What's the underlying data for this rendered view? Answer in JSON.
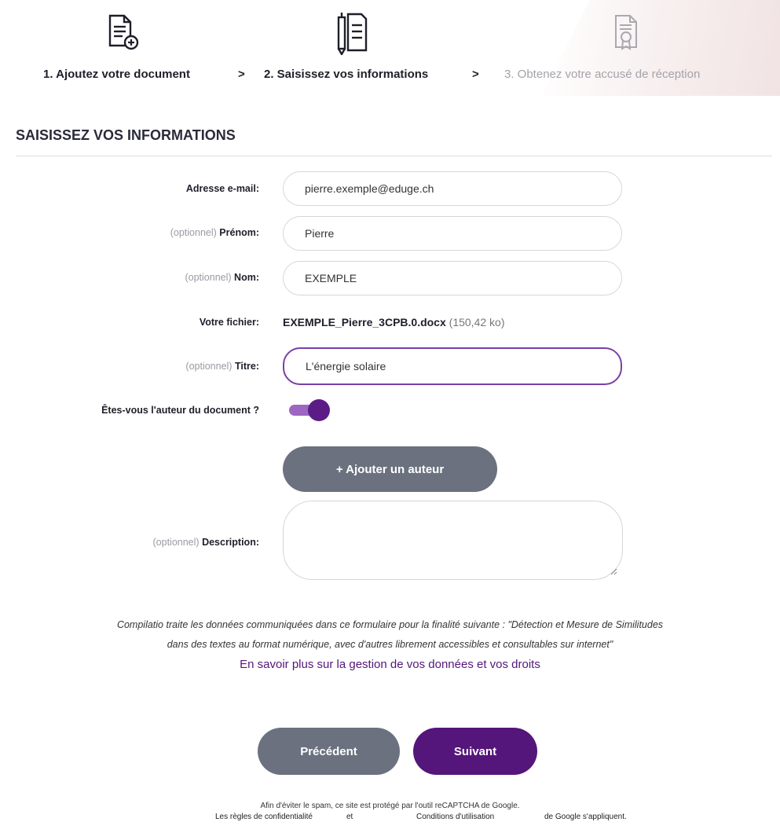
{
  "steps": [
    {
      "label": "1. Ajoutez votre document",
      "state": "done",
      "icon": "document-add-icon"
    },
    {
      "label": "2. Saisissez vos informations",
      "state": "current",
      "icon": "document-edit-icon"
    },
    {
      "label": "3. Obtenez votre accusé de réception",
      "state": "upcoming",
      "icon": "certificate-icon"
    }
  ],
  "step_separator": ">",
  "section_title": "SAISISSEZ VOS INFORMATIONS",
  "form": {
    "email": {
      "label": "Adresse e-mail:",
      "value": "pierre.exemple@eduge.ch"
    },
    "first_name": {
      "optional": "(optionnel)",
      "label": "Prénom:",
      "value": "Pierre"
    },
    "last_name": {
      "optional": "(optionnel)",
      "label": "Nom:",
      "value": "EXEMPLE"
    },
    "file": {
      "label": "Votre fichier:",
      "name": "EXEMPLE_Pierre_3CPB.0.docx",
      "size": "(150,42 ko)"
    },
    "title": {
      "optional": "(optionnel)",
      "label": "Titre:",
      "value": "L'énergie solaire"
    },
    "author_question": {
      "label": "Êtes-vous l'auteur du document ?",
      "on": true
    },
    "add_author_label": "+ Ajouter un auteur",
    "description": {
      "optional": "(optionnel)",
      "label": "Description:",
      "value": ""
    }
  },
  "notice": {
    "line1": "Compilatio traite les données communiquées dans ce formulaire pour la finalité suivante : \"Détection et Mesure de Similitudes",
    "line2": "dans des textes au format numérique, avec d'autres librement accessibles et consultables sur internet\"",
    "link": "En savoir plus sur la gestion de vos données et vos droits"
  },
  "buttons": {
    "previous": "Précédent",
    "next": "Suivant"
  },
  "captcha": {
    "line1": "Afin d'éviter le spam, ce site est protégé par l'outil reCAPTCHA de Google.",
    "privacy": "Les règles de confidentialité",
    "and": "et",
    "terms": "Conditions d'utilisation",
    "suffix": "de Google s'appliquent."
  },
  "colors": {
    "accent": "#54167a",
    "toggle_track": "#9d66c2",
    "button_grey": "#6b717e"
  }
}
